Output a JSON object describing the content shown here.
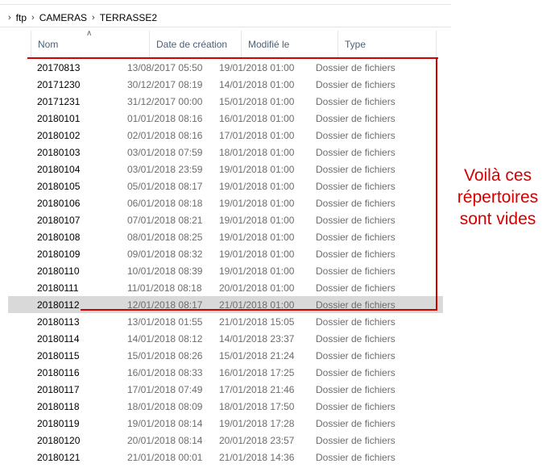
{
  "breadcrumb": [
    "ftp",
    "CAMERAS",
    "TERRASSE2"
  ],
  "columns": {
    "name": "Nom",
    "created": "Date de création",
    "modified": "Modifié le",
    "type": "Type"
  },
  "rows": [
    {
      "name": "20170813",
      "created": "13/08/2017 05:50",
      "modified": "19/01/2018 01:00",
      "type": "Dossier de fichiers"
    },
    {
      "name": "20171230",
      "created": "30/12/2017 08:19",
      "modified": "14/01/2018 01:00",
      "type": "Dossier de fichiers"
    },
    {
      "name": "20171231",
      "created": "31/12/2017 00:00",
      "modified": "15/01/2018 01:00",
      "type": "Dossier de fichiers"
    },
    {
      "name": "20180101",
      "created": "01/01/2018 08:16",
      "modified": "16/01/2018 01:00",
      "type": "Dossier de fichiers"
    },
    {
      "name": "20180102",
      "created": "02/01/2018 08:16",
      "modified": "17/01/2018 01:00",
      "type": "Dossier de fichiers"
    },
    {
      "name": "20180103",
      "created": "03/01/2018 07:59",
      "modified": "18/01/2018 01:00",
      "type": "Dossier de fichiers"
    },
    {
      "name": "20180104",
      "created": "03/01/2018 23:59",
      "modified": "19/01/2018 01:00",
      "type": "Dossier de fichiers"
    },
    {
      "name": "20180105",
      "created": "05/01/2018 08:17",
      "modified": "19/01/2018 01:00",
      "type": "Dossier de fichiers"
    },
    {
      "name": "20180106",
      "created": "06/01/2018 08:18",
      "modified": "19/01/2018 01:00",
      "type": "Dossier de fichiers"
    },
    {
      "name": "20180107",
      "created": "07/01/2018 08:21",
      "modified": "19/01/2018 01:00",
      "type": "Dossier de fichiers"
    },
    {
      "name": "20180108",
      "created": "08/01/2018 08:25",
      "modified": "19/01/2018 01:00",
      "type": "Dossier de fichiers"
    },
    {
      "name": "20180109",
      "created": "09/01/2018 08:32",
      "modified": "19/01/2018 01:00",
      "type": "Dossier de fichiers"
    },
    {
      "name": "20180110",
      "created": "10/01/2018 08:39",
      "modified": "19/01/2018 01:00",
      "type": "Dossier de fichiers"
    },
    {
      "name": "20180111",
      "created": "11/01/2018 08:18",
      "modified": "20/01/2018 01:00",
      "type": "Dossier de fichiers"
    },
    {
      "name": "20180112",
      "created": "12/01/2018 08:17",
      "modified": "21/01/2018 01:00",
      "type": "Dossier de fichiers",
      "selected": true
    },
    {
      "name": "20180113",
      "created": "13/01/2018 01:55",
      "modified": "21/01/2018 15:05",
      "type": "Dossier de fichiers"
    },
    {
      "name": "20180114",
      "created": "14/01/2018 08:12",
      "modified": "14/01/2018 23:37",
      "type": "Dossier de fichiers"
    },
    {
      "name": "20180115",
      "created": "15/01/2018 08:26",
      "modified": "15/01/2018 21:24",
      "type": "Dossier de fichiers"
    },
    {
      "name": "20180116",
      "created": "16/01/2018 08:33",
      "modified": "16/01/2018 17:25",
      "type": "Dossier de fichiers"
    },
    {
      "name": "20180117",
      "created": "17/01/2018 07:49",
      "modified": "17/01/2018 21:46",
      "type": "Dossier de fichiers"
    },
    {
      "name": "20180118",
      "created": "18/01/2018 08:09",
      "modified": "18/01/2018 17:50",
      "type": "Dossier de fichiers"
    },
    {
      "name": "20180119",
      "created": "19/01/2018 08:14",
      "modified": "19/01/2018 17:28",
      "type": "Dossier de fichiers"
    },
    {
      "name": "20180120",
      "created": "20/01/2018 08:14",
      "modified": "20/01/2018 23:57",
      "type": "Dossier de fichiers"
    },
    {
      "name": "20180121",
      "created": "21/01/2018 00:01",
      "modified": "21/01/2018 14:36",
      "type": "Dossier de fichiers"
    }
  ],
  "annotation": {
    "lines": [
      "Voilà ces",
      "répertoires",
      "sont vides"
    ],
    "color": "#d40000"
  },
  "icons": {
    "breadcrumb_chevron": "chevron-right-icon",
    "sort_indicator": "sort-ascending-icon"
  }
}
